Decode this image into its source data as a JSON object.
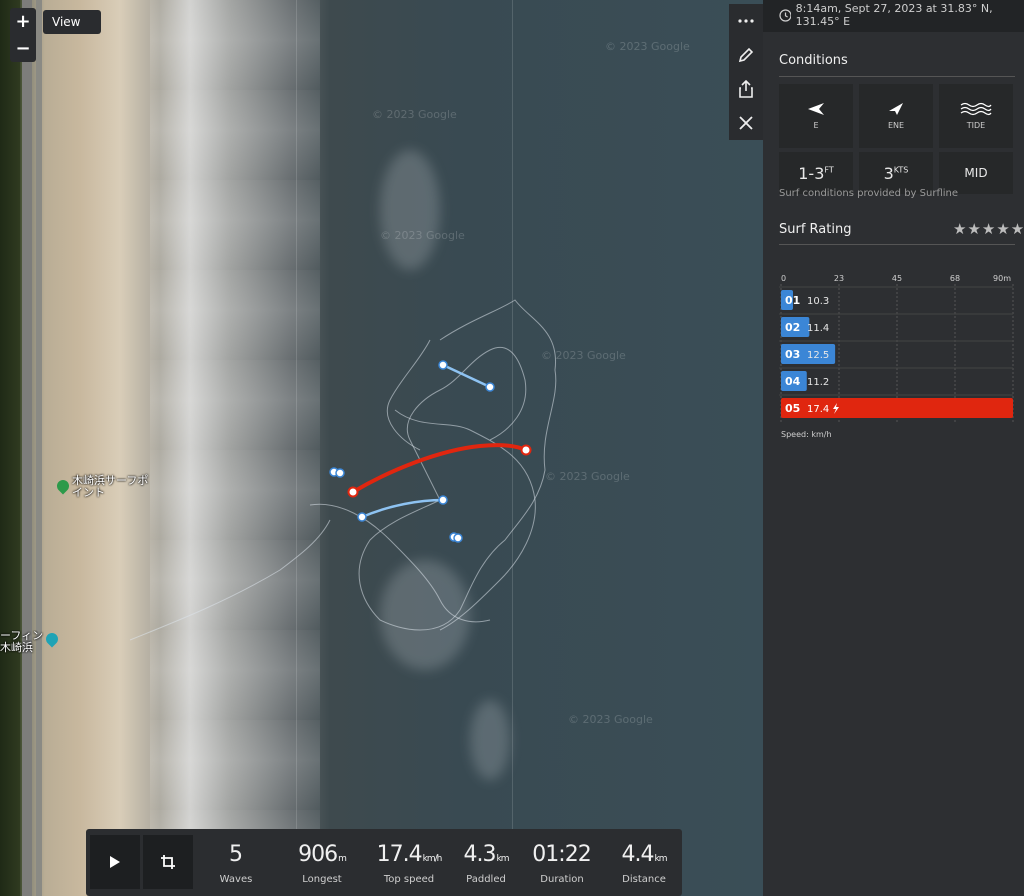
{
  "map": {
    "zoom_in": "+",
    "zoom_out": "−",
    "view_label": "View",
    "watermarks": [
      "© 2023 Google",
      "© 2023 Google",
      "© 2023 Google",
      "© 2023 Google",
      "© 2023 Google",
      "© 2023 Google"
    ],
    "poi_1": "木崎浜サーフポイント",
    "poi_2": "ーフィン木崎浜",
    "tools": [
      "more-icon",
      "pencil-icon",
      "share-icon",
      "close-icon"
    ]
  },
  "stats": {
    "items": [
      {
        "value": "5",
        "unit": "",
        "label": "Waves"
      },
      {
        "value": "906",
        "unit": "m",
        "label": "Longest"
      },
      {
        "value": "17.4",
        "unit": "km/h",
        "label": "Top speed"
      },
      {
        "value": "4.3",
        "unit": "km",
        "label": "Paddled"
      },
      {
        "value": "01:22",
        "unit": "",
        "label": "Duration"
      },
      {
        "value": "4.4",
        "unit": "km",
        "label": "Distance"
      }
    ]
  },
  "panel": {
    "timestamp": "8:14am, Sept 27, 2023 at 31.83° N, 131.45° E",
    "conditions_title": "Conditions",
    "swell_dir": "E",
    "wind_dir": "ENE",
    "tide_label": "TIDE",
    "swell_value": "1-3",
    "swell_unit": "FT",
    "wind_value": "3",
    "wind_unit": "KTS",
    "tide_value": "MID",
    "provided_by": "Surf conditions provided by Surfline",
    "rating_title": "Surf Rating",
    "stars": "★★★★★",
    "speed_note": "Speed: km/h"
  },
  "chart_data": {
    "type": "bar",
    "orientation": "horizontal",
    "axis_ticks": [
      "0",
      "23",
      "45",
      "68",
      "90m"
    ],
    "xlim": [
      0,
      90
    ],
    "categories": [
      "01",
      "02",
      "03",
      "04",
      "05"
    ],
    "lengths_m": [
      4,
      11,
      21,
      10,
      906
    ],
    "speeds": [
      "10.3",
      "11.4",
      "12.5",
      "11.2",
      "17.4"
    ],
    "highlight": "05",
    "colors": {
      "normal": "#3b86d6",
      "highlight": "#e0260f"
    }
  }
}
